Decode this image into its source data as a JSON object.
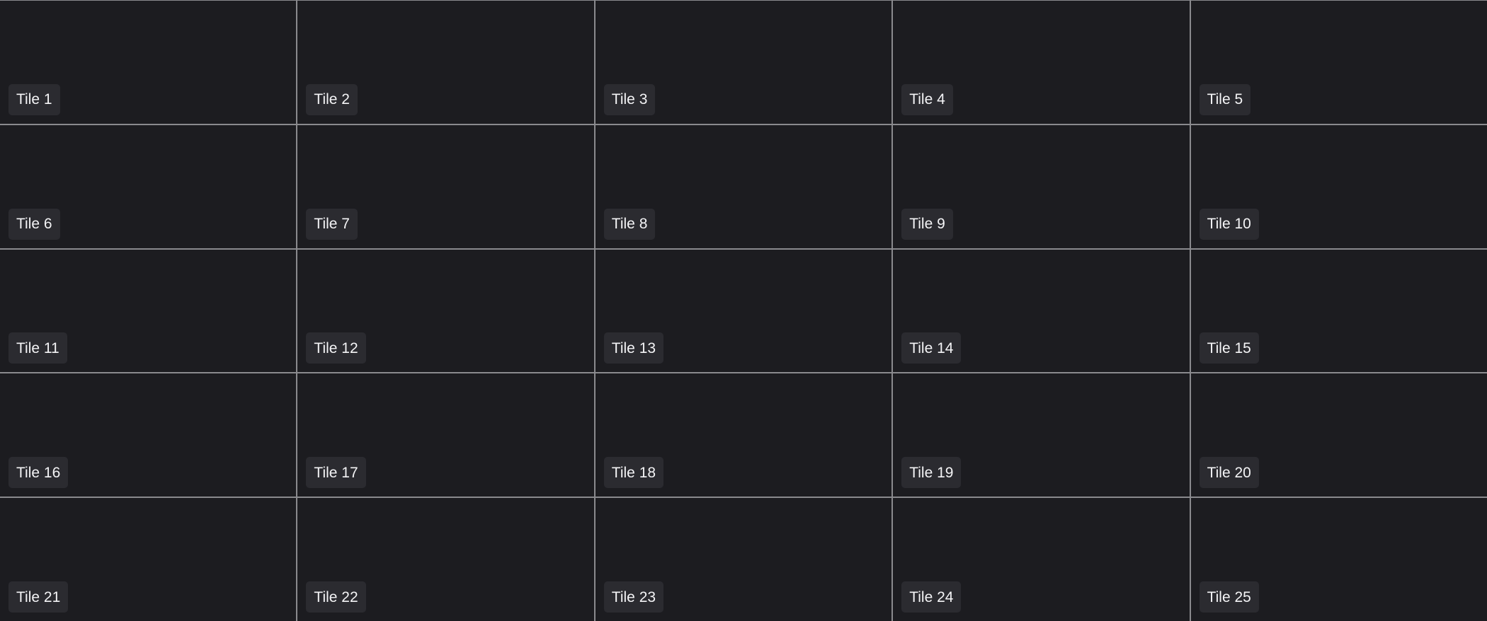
{
  "tiles": [
    {
      "label": "Tile 1"
    },
    {
      "label": "Tile 2"
    },
    {
      "label": "Tile 3"
    },
    {
      "label": "Tile 4"
    },
    {
      "label": "Tile 5"
    },
    {
      "label": "Tile 6"
    },
    {
      "label": "Tile 7"
    },
    {
      "label": "Tile 8"
    },
    {
      "label": "Tile 9"
    },
    {
      "label": "Tile 10"
    },
    {
      "label": "Tile 11"
    },
    {
      "label": "Tile 12"
    },
    {
      "label": "Tile 13"
    },
    {
      "label": "Tile 14"
    },
    {
      "label": "Tile 15"
    },
    {
      "label": "Tile 16"
    },
    {
      "label": "Tile 17"
    },
    {
      "label": "Tile 18"
    },
    {
      "label": "Tile 19"
    },
    {
      "label": "Tile 20"
    },
    {
      "label": "Tile 21"
    },
    {
      "label": "Tile 22"
    },
    {
      "label": "Tile 23"
    },
    {
      "label": "Tile 24"
    },
    {
      "label": "Tile 25"
    }
  ],
  "colors": {
    "tile_background": "#1c1c20",
    "grid_lines": "#8a8a8e",
    "label_background": "#2b2b30",
    "label_text": "#f4f4f6"
  }
}
